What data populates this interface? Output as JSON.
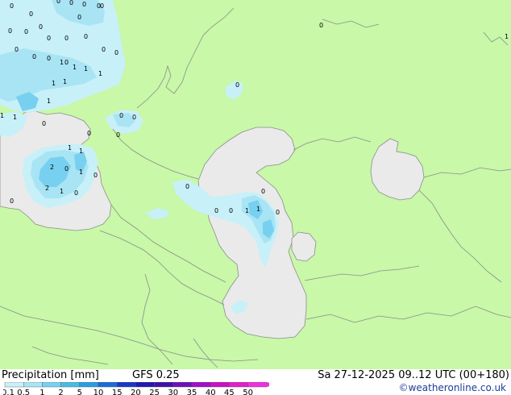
{
  "footer": {
    "title": "Precipitation [mm]",
    "model": "GFS 0.25",
    "validity": "Sa 27-12-2025 09..12 UTC (00+180)",
    "credit": "©weatheronline.co.uk"
  },
  "legend": {
    "ticks": [
      "0.1",
      "0.5",
      "1",
      "2",
      "5",
      "10",
      "15",
      "20",
      "25",
      "30",
      "35",
      "40",
      "45",
      "50"
    ],
    "colors": [
      "#c8f0f8",
      "#a8e4f4",
      "#78d0f0",
      "#48bce8",
      "#2c9ce0",
      "#1c6cd8",
      "#1838c8",
      "#2018b0",
      "#4010a8",
      "#7010b8",
      "#a010c8",
      "#c810c8",
      "#e020c8",
      "#f030e0"
    ]
  },
  "colors": {
    "land": "#c8f8a8",
    "sea": "#eaeaea",
    "border": "#8c8c8c",
    "precip_light": "#c8f0f8",
    "precip_mid": "#a8e4f4",
    "precip_heavy": "#78d0f0"
  },
  "map_labels": [
    "0",
    "0",
    "0",
    "0",
    "0",
    "0",
    "0",
    "0",
    "0",
    "0",
    "0",
    "0",
    "0",
    "0",
    "0",
    "0",
    "0",
    "0",
    "0",
    "0",
    "1",
    "1",
    "1",
    "1",
    "1",
    "1",
    "1",
    "0",
    "1",
    "1",
    "0",
    "0",
    "0",
    "0",
    "0",
    "0",
    "1",
    "1",
    "2",
    "0",
    "1",
    "0",
    "2",
    "1",
    "0",
    "0",
    "0",
    "0",
    "0",
    "1",
    "1",
    "0",
    "0",
    "1"
  ]
}
